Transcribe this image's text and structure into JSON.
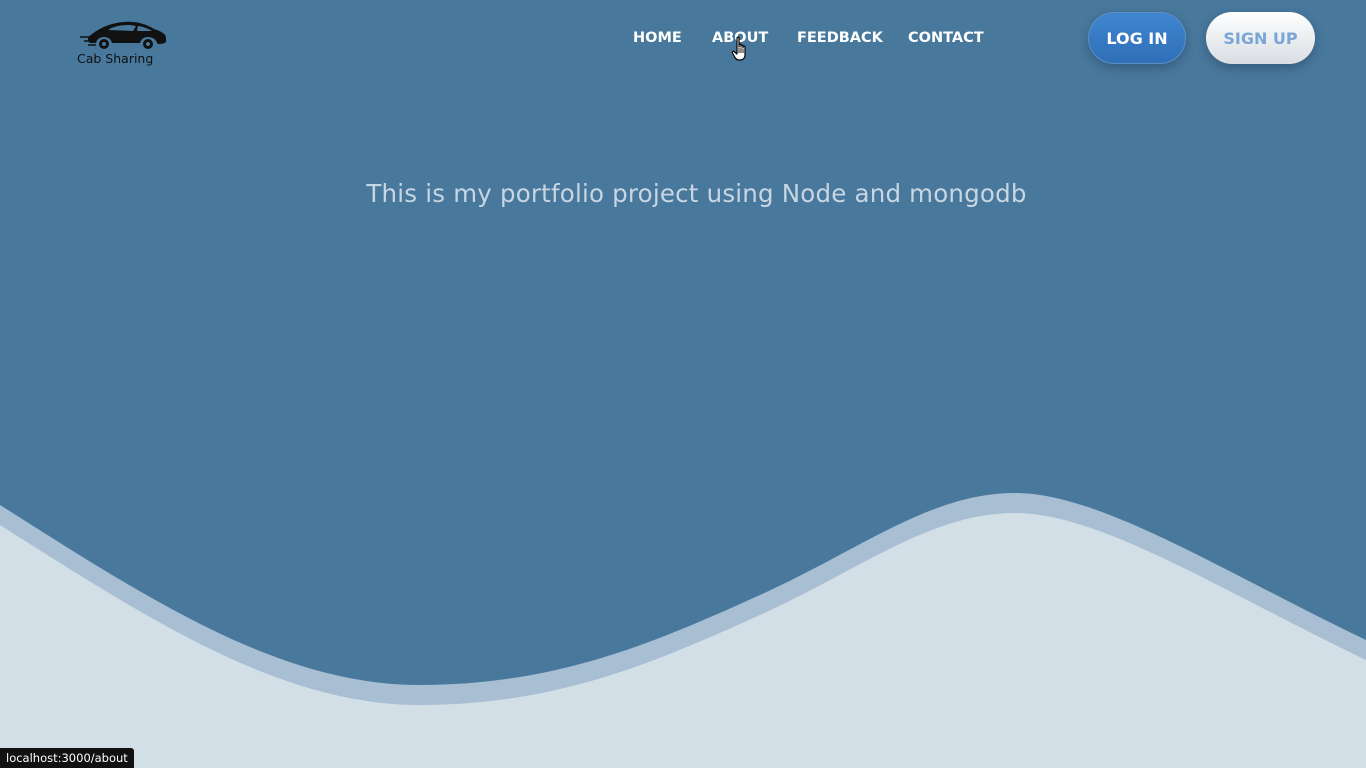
{
  "brand": {
    "name": "Cab Sharing",
    "logo_icon": "car-icon"
  },
  "nav": {
    "items": [
      {
        "label": "HOME"
      },
      {
        "label": "ABOUT"
      },
      {
        "label": "FEEDBACK"
      },
      {
        "label": "CONTACT"
      }
    ],
    "hovered": "ABOUT"
  },
  "auth": {
    "login_label": "LOG IN",
    "signup_label": "SIGN UP"
  },
  "hero": {
    "headline": "This is my portfolio project using Node and mongodb"
  },
  "status_bar": {
    "url": "localhost:3000/about"
  },
  "colors": {
    "background": "#48789c",
    "wave_outer": "#a8bed2",
    "wave_inner": "#d3dfe7",
    "login_button": "#3a7fc8",
    "signup_text": "#7aa6d6",
    "headline_text": "#c7d6e2"
  },
  "cursor": {
    "type": "hand-pointer-icon"
  }
}
